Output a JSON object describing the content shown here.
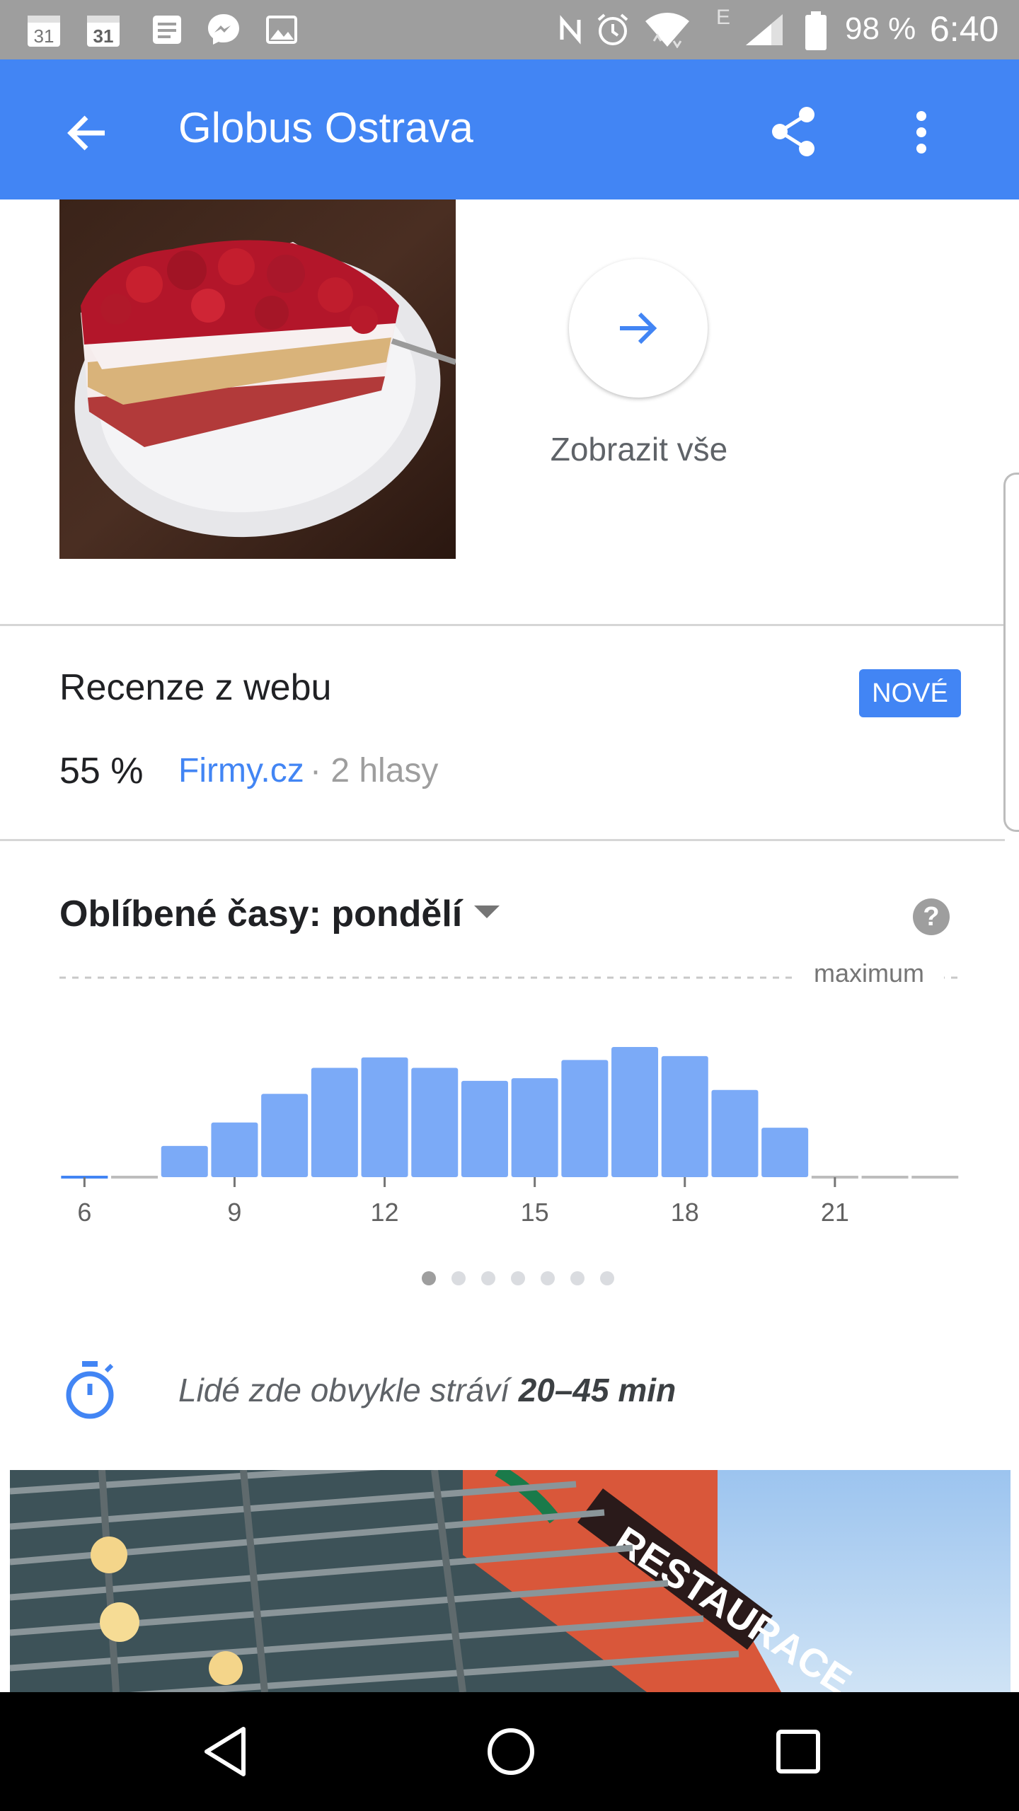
{
  "status_bar": {
    "battery": "98 %",
    "time": "6:40",
    "calendar_day_1": "31",
    "calendar_day_2": "31",
    "network_type": "E",
    "icons": [
      "calendar-icon",
      "calendar-icon",
      "notes-icon",
      "messenger-icon",
      "gallery-icon",
      "nfc-icon",
      "alarm-icon",
      "wifi-icon",
      "signal-icon",
      "battery-icon"
    ]
  },
  "app_bar": {
    "title": "Globus Ostrava",
    "icons": [
      "back-arrow-icon",
      "share-icon",
      "more-vert-icon"
    ]
  },
  "photos": {
    "view_all_label": "Zobrazit vše"
  },
  "reviews": {
    "title": "Recenze z webu",
    "badge": "NOVÉ",
    "score": "55 %",
    "source": "Firmy.cz",
    "votes": "· 2 hlasy"
  },
  "popular_times": {
    "title": "Oblíbené časy: pondělí",
    "max_label": "maximum",
    "page_count": 7,
    "active_page": 0
  },
  "chart_data": {
    "type": "bar",
    "x": [
      6,
      7,
      8,
      9,
      10,
      11,
      12,
      13,
      14,
      15,
      16,
      17,
      18,
      19,
      20,
      21,
      22,
      23
    ],
    "values": [
      0,
      0,
      24,
      42,
      64,
      84,
      92,
      84,
      74,
      76,
      90,
      100,
      93,
      67,
      38,
      0,
      0,
      0
    ],
    "x_tick_labels": [
      "6",
      "9",
      "12",
      "15",
      "18",
      "21"
    ],
    "ylim": [
      0,
      100
    ],
    "reference_line": "maximum",
    "grid": false,
    "bar_color": "#7baaf7",
    "current_hour_color": "#4285f4"
  },
  "visit_duration": {
    "text_prefix": "Lidé zde obvykle stráví",
    "duration": "20–45 min"
  },
  "building_sign": "RESTAURACE",
  "colors": {
    "accent": "#4285f4",
    "status_bar": "#9e9e9e"
  }
}
